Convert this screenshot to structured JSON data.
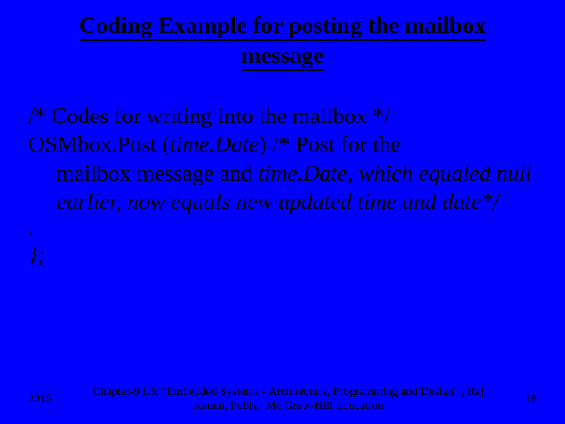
{
  "title_line1": "Coding Example for posting the mailbox",
  "title_line2": "message",
  "body": {
    "line1": "/* Codes for writing into the mailbox */",
    "line2_a": "OSMbox.Post (",
    "line2_b": "time.Date",
    "line2_c": ") /* Post for the ",
    "indent_a": "mailbox message and ",
    "indent_b": "time.Date, which equaled null earlier, now equals  new updated  time and date*/",
    "dot": ".",
    "close": "};"
  },
  "footer": {
    "left": "2015",
    "center": "Chapter-9 L5: \"Embedded Systems - Architecture, Programming and Design\" , Raj Kamal, Publs.: Mc.Graw-Hill Education",
    "right": "18"
  }
}
